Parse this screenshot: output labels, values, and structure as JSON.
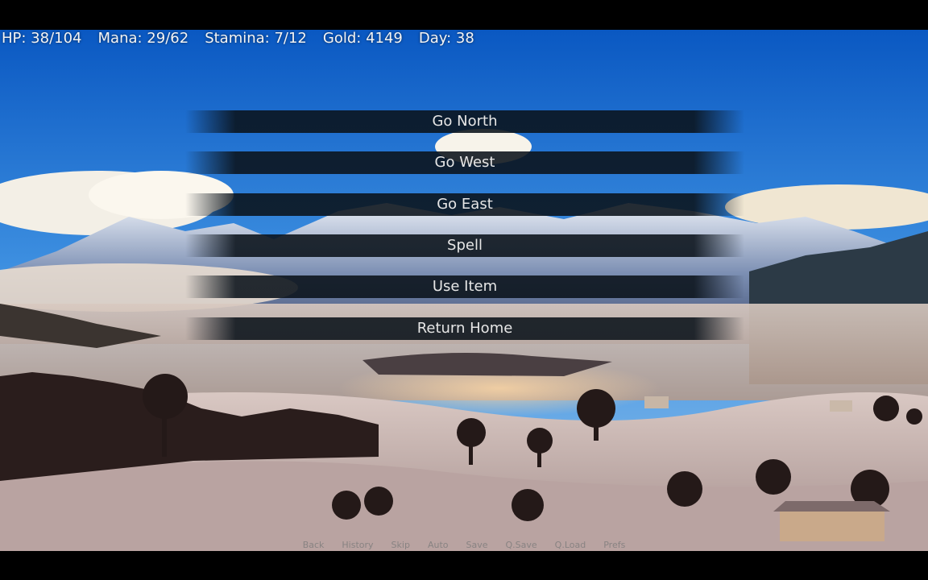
{
  "hud": {
    "hp": "HP: 38/104",
    "mana": "Mana: 29/62",
    "stamina": "Stamina: 7/12",
    "gold": "Gold: 4149",
    "day": "Day: 38"
  },
  "menu": {
    "choices": [
      {
        "label": "Go North"
      },
      {
        "label": "Go West"
      },
      {
        "label": "Go East"
      },
      {
        "label": "Spell"
      },
      {
        "label": "Use Item"
      },
      {
        "label": "Return Home"
      }
    ]
  },
  "quick_menu": {
    "items": [
      "Back",
      "History",
      "Skip",
      "Auto",
      "Save",
      "Q.Save",
      "Q.Load",
      "Prefs"
    ]
  },
  "colors": {
    "sky_top": "#0b5fc8",
    "sky_bottom": "#6fb0ea",
    "choice_bg": "#0a121a",
    "text": "#e6e6e6"
  }
}
